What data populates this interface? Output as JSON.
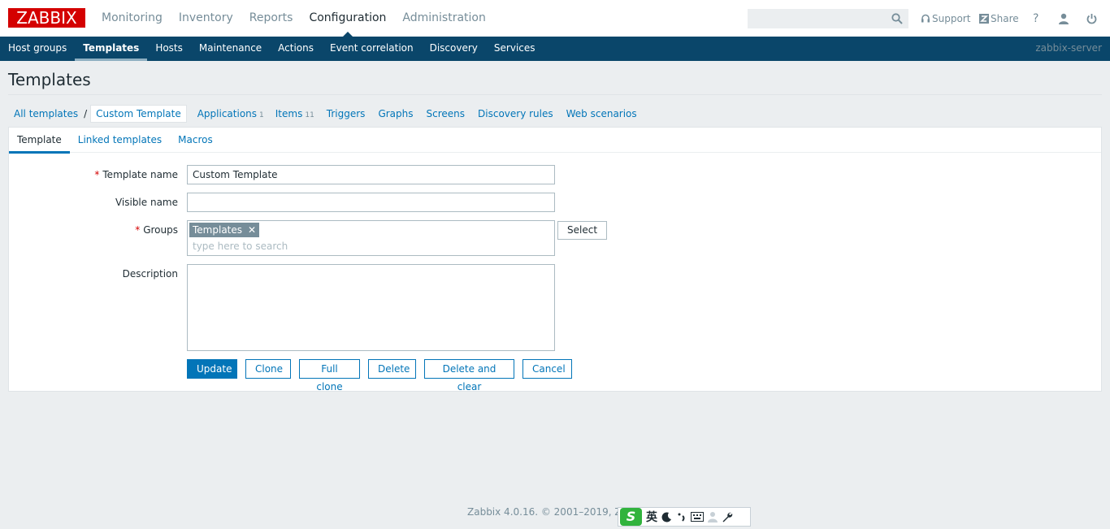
{
  "logo_text": "ZABBIX",
  "main_menu": [
    "Monitoring",
    "Inventory",
    "Reports",
    "Configuration",
    "Administration"
  ],
  "main_menu_active": "Configuration",
  "search": {
    "value": ""
  },
  "top_utils": {
    "support": "Support",
    "share": "Share",
    "help": "?"
  },
  "sub_menu": [
    "Host groups",
    "Templates",
    "Hosts",
    "Maintenance",
    "Actions",
    "Event correlation",
    "Discovery",
    "Services"
  ],
  "sub_menu_active": "Templates",
  "server_name": "zabbix-server",
  "page_title": "Templates",
  "breadcrumbs": {
    "all": "All templates",
    "sep": "/",
    "current": "Custom Template",
    "applications": "Applications",
    "applications_count": "1",
    "items": "Items",
    "items_count": "11",
    "triggers": "Triggers",
    "graphs": "Graphs",
    "screens": "Screens",
    "discovery": "Discovery rules",
    "web": "Web scenarios"
  },
  "tabs": [
    "Template",
    "Linked templates",
    "Macros"
  ],
  "form": {
    "required_mark": "*",
    "template_name_label": "Template name",
    "template_name_value": "Custom Template",
    "visible_name_label": "Visible name",
    "visible_name_value": "",
    "groups_label": "Groups",
    "group_tag": "Templates",
    "group_tag_remove": "✕",
    "groups_placeholder": "type here to search",
    "select_label": "Select",
    "description_label": "Description",
    "description_value": ""
  },
  "buttons": {
    "update": "Update",
    "clone": "Clone",
    "full_clone": "Full clone",
    "delete": "Delete",
    "delete_clear": "Delete and clear",
    "cancel": "Cancel"
  },
  "footer": "Zabbix 4.0.16. © 2001–2019, Zabbi",
  "ime": {
    "logo": "S",
    "lang": "英"
  }
}
